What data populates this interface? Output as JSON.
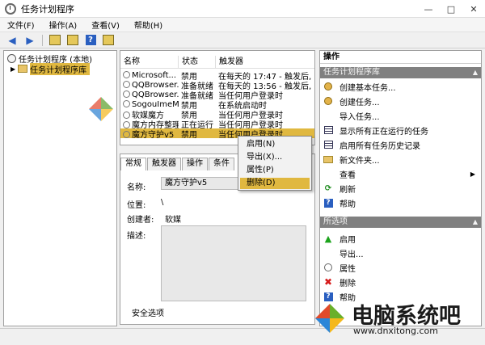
{
  "window": {
    "title": "任务计划程序",
    "controls": [
      "—",
      "□",
      "✕"
    ]
  },
  "menubar": [
    "文件(F)",
    "操作(A)",
    "查看(V)",
    "帮助(H)"
  ],
  "tree": {
    "root": "任务计划程序 (本地)",
    "child": "任务计划程序库"
  },
  "task_list": {
    "columns": [
      "名称",
      "状态",
      "触发器"
    ],
    "rows": [
      {
        "name": "Microsoft...",
        "status": "禁用",
        "trigger": "在每天的 17:47 - 触发后,"
      },
      {
        "name": "QQBrowser...",
        "status": "准备就绪",
        "trigger": "在每天的 13:56 - 触发后,"
      },
      {
        "name": "QQBrowser...",
        "status": "准备就绪",
        "trigger": "当任何用户登录时"
      },
      {
        "name": "SogouImeMgr",
        "status": "禁用",
        "trigger": "在系统启动时"
      },
      {
        "name": "软媒魔方",
        "status": "禁用",
        "trigger": "当任何用户登录时"
      },
      {
        "name": "魔方内存整理",
        "status": "正在运行",
        "trigger": "当任何用户登录时"
      },
      {
        "name": "魔方守护v5",
        "status": "禁用",
        "trigger": "当任何用户登录时"
      }
    ]
  },
  "context_menu": {
    "items": [
      "启用(N)",
      "导出(X)...",
      "属性(P)",
      "删除(D)"
    ]
  },
  "details": {
    "tabs": [
      "常规",
      "触发器",
      "操作",
      "条件"
    ],
    "name_label": "名称:",
    "name_value": "魔方守护v5",
    "location_label": "位置:",
    "location_value": "\\",
    "author_label": "创建者:",
    "author_value": "软媒",
    "description_label": "描述:",
    "security_label": "安全选项"
  },
  "actions": {
    "header": "操作",
    "section1": "任务计划程序库",
    "section1_items": [
      "创建基本任务...",
      "创建任务...",
      "导入任务...",
      "显示所有正在运行的任务",
      "启用所有任务历史记录",
      "新文件夹...",
      "查看",
      "刷新",
      "帮助"
    ],
    "section2": "所选项",
    "section2_items": [
      "启用",
      "导出...",
      "属性",
      "删除",
      "帮助"
    ]
  },
  "watermark": {
    "brand_name": "电脑系统吧",
    "brand_url": "www.dnxitong.com"
  }
}
